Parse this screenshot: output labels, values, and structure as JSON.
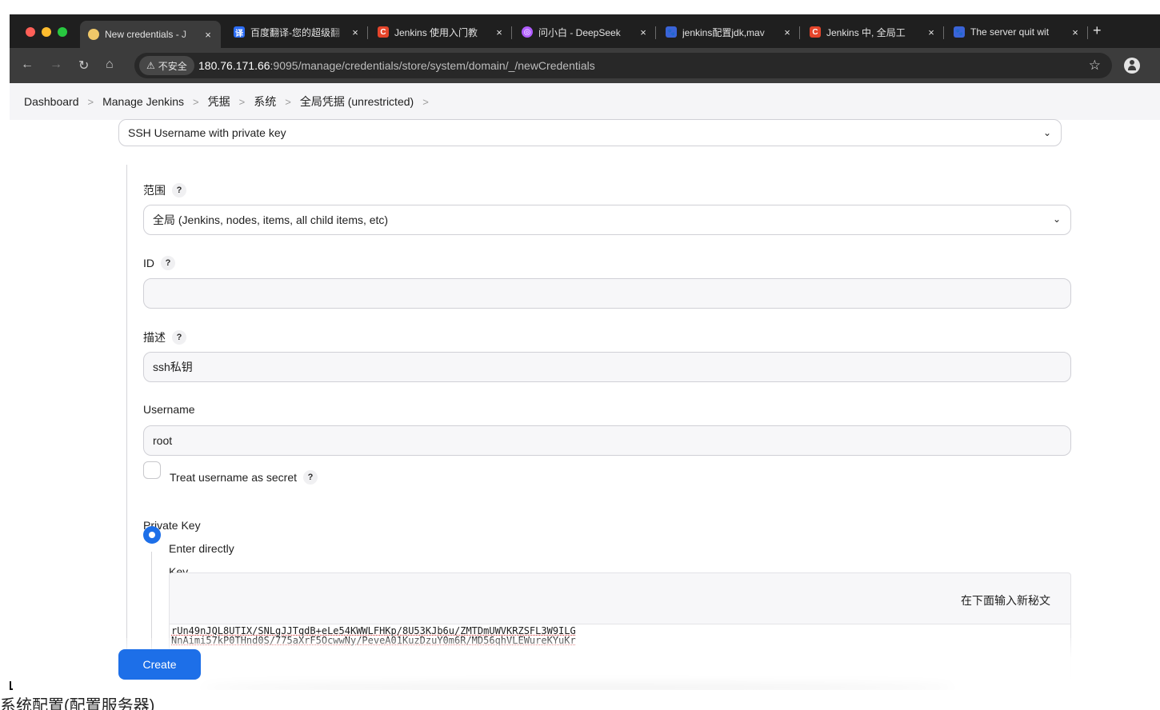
{
  "browser": {
    "tabs": [
      {
        "title": "New credentials - J",
        "icon": "jenkins-butler-icon",
        "color": "#f0c869",
        "active": true
      },
      {
        "title": "百度翻译-您的超级翻",
        "icon": "baidu-translate-icon",
        "color": "#2d6ef7",
        "glyph": "译"
      },
      {
        "title": "Jenkins 使用入门教",
        "icon": "csdn-icon",
        "color": "#e5452b",
        "glyph": "C"
      },
      {
        "title": "问小白 - DeepSeek",
        "icon": "wenxiaobai-icon",
        "color": "#b05cff",
        "glyph": "◎"
      },
      {
        "title": "jenkins配置jdk,mav",
        "icon": "baidu-paw-icon",
        "color": "#3a64d8",
        "glyph": "🐾"
      },
      {
        "title": "Jenkins 中, 全局工",
        "icon": "csdn-icon",
        "color": "#e5452b",
        "glyph": "C"
      },
      {
        "title": "The server quit wit",
        "icon": "baidu-paw-icon",
        "color": "#3a64d8",
        "glyph": "🐾"
      }
    ],
    "close_glyph": "×",
    "new_tab_glyph": "+",
    "security_label": "不安全",
    "url_host": "180.76.171.66",
    "url_path": ":9095/manage/credentials/store/system/domain/_/newCredentials"
  },
  "breadcrumb": [
    "Dashboard",
    "Manage Jenkins",
    "凭据",
    "系统",
    "全局凭据 (unrestricted)"
  ],
  "form": {
    "kind_value": "SSH Username with private key",
    "scope_label": "范围",
    "scope_value": "全局 (Jenkins, nodes, items, all child items, etc)",
    "id_label": "ID",
    "id_value": "",
    "description_label": "描述",
    "description_value": "ssh私钥",
    "username_label": "Username",
    "username_value": "root",
    "secret_checkbox_label": "Treat username as secret",
    "private_key_label": "Private Key",
    "enter_directly_label": "Enter directly",
    "key_label": "Key",
    "key_hint": "在下面输入新秘文",
    "key_lines": [
      "rUn49nJQL8UTIX/SNLgJJTqdB+eLe54KWWLFHKp/8U53KJb6u/ZMTDmUWVKRZSFL3W9ILG",
      "NnAimi57kP0THnd0S/775aXrF5OcwwNy/PeveA01KuzDzuY0m6R/MD56qhVLEWureKYuKr"
    ],
    "help_glyph": "?",
    "create_label": "Create"
  },
  "below_caption": "系统配置(配置服务器)"
}
